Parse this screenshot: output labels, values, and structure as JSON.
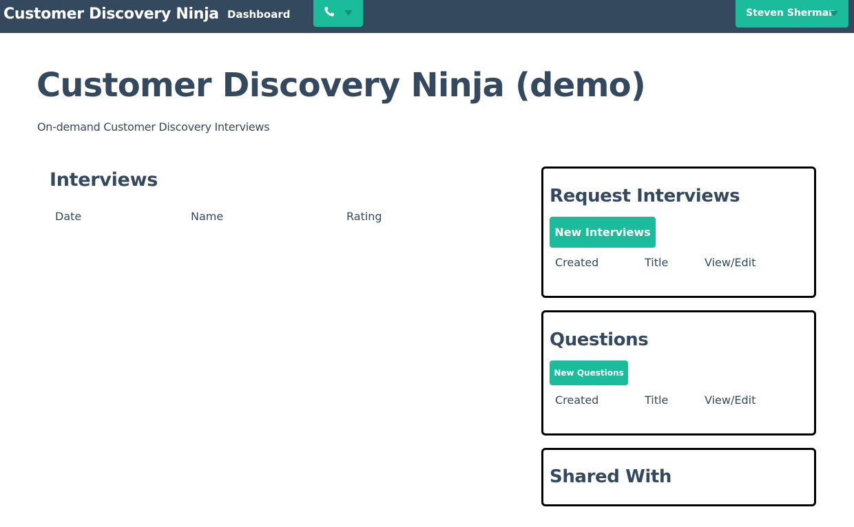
{
  "navbar": {
    "brand": "Customer Discovery Ninja",
    "dashboard_link": "Dashboard",
    "phone_icon": "phone-icon",
    "user_name": "Steven Sherman"
  },
  "page": {
    "title": "Customer Discovery Ninja (demo)",
    "tagline": "On-demand Customer Discovery Interviews"
  },
  "interviews": {
    "title": "Interviews",
    "columns": [
      "Date",
      "Name",
      "Rating"
    ]
  },
  "request_panel": {
    "title": "Request Interviews",
    "button": "New Interviews",
    "columns": [
      "Created",
      "Title",
      "View/Edit"
    ]
  },
  "questions_panel": {
    "title": "Questions",
    "button": "New Questions",
    "columns": [
      "Created",
      "Title",
      "View/Edit"
    ]
  },
  "shared_panel": {
    "title": "Shared With"
  },
  "colors": {
    "navbar": "#34495e",
    "accent": "#1abc9c",
    "text": "#34495e",
    "panel_border": "#000000"
  }
}
